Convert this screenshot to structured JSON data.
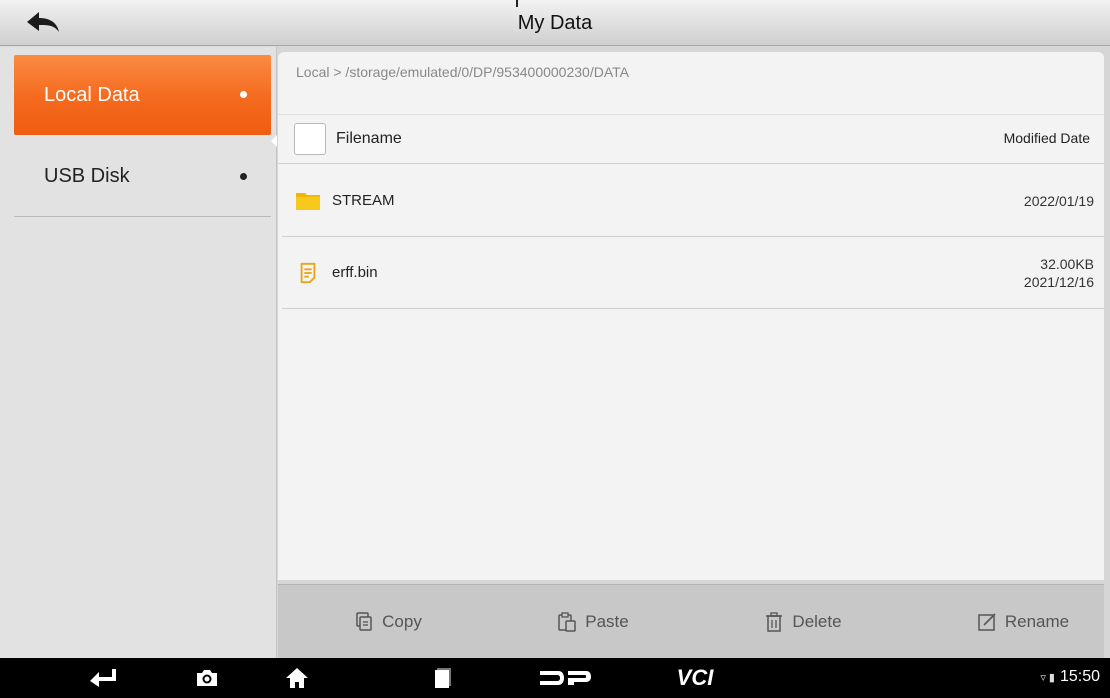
{
  "header": {
    "title": "My Data"
  },
  "sidebar": {
    "items": [
      {
        "label": "Local Data"
      },
      {
        "label": "USB Disk"
      }
    ]
  },
  "main": {
    "breadcrumb": "Local > /storage/emulated/0/DP/953400000230/DATA",
    "columns": {
      "name": "Filename",
      "date": "Modified Date"
    },
    "rows": [
      {
        "name": "STREAM",
        "type": "folder",
        "size": "",
        "date": "2022/01/19"
      },
      {
        "name": "erff.bin",
        "type": "file",
        "size": "32.00KB",
        "date": "2021/12/16"
      }
    ]
  },
  "toolbar": {
    "copy": "Copy",
    "paste": "Paste",
    "delete": "Delete",
    "rename": "Rename"
  },
  "navbar": {
    "vci": "VCI",
    "time": "15:50"
  },
  "colors": {
    "accent": "#f46a1e",
    "folder": "#f5c518",
    "file": "#e8a317"
  }
}
